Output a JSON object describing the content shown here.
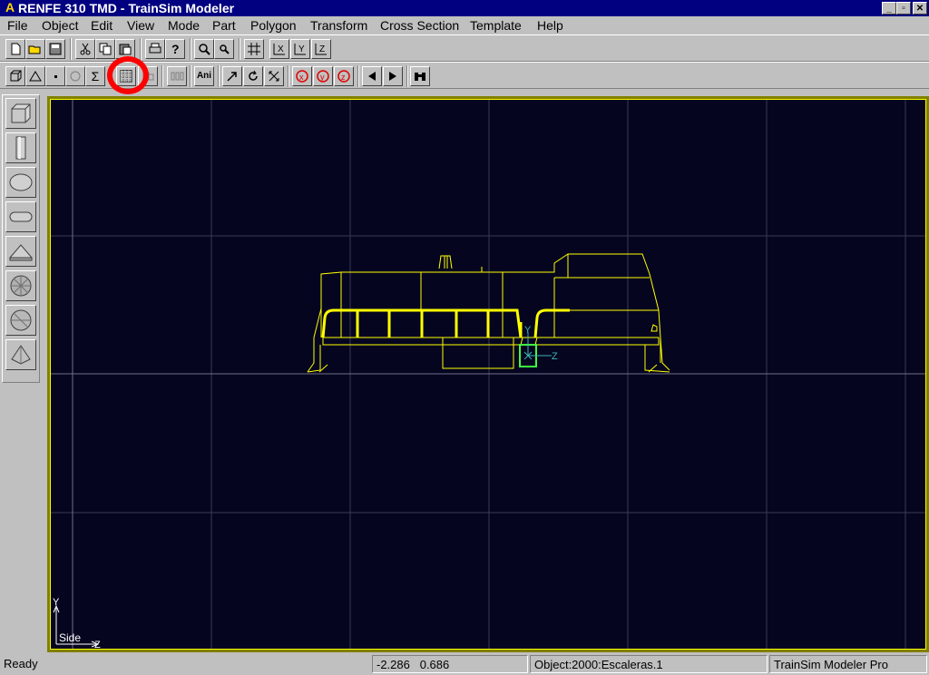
{
  "window": {
    "title": "RENFE 310 TMD - TrainSim Modeler",
    "app_icon": "A",
    "minimize_glyph": "_",
    "maximize_glyph": "▫",
    "close_glyph": "✕"
  },
  "menu": [
    "File",
    "Object",
    "Edit",
    "View",
    "Mode",
    "Part",
    "Polygon",
    "Transform",
    "Cross Section",
    "Template",
    "Help"
  ],
  "toolbar2": {
    "sigma_label": "Σ",
    "ani_label": "Ani"
  },
  "viewport": {
    "view_label": "Side",
    "axis_y_label": "Y",
    "axis_z_label": "Z",
    "gizmo_y_label": "Y",
    "gizmo_z_label": "Z",
    "background_color": "#050520",
    "wire_color": "#ffff00",
    "selection_color": "#40ff40"
  },
  "status": {
    "ready": "Ready",
    "coord_x": "-2.286",
    "coord_y": "0.686",
    "object": "Object:2000:Escaleras.1",
    "product": "TrainSim Modeler Pro"
  },
  "highlight_color": "#ff0000"
}
